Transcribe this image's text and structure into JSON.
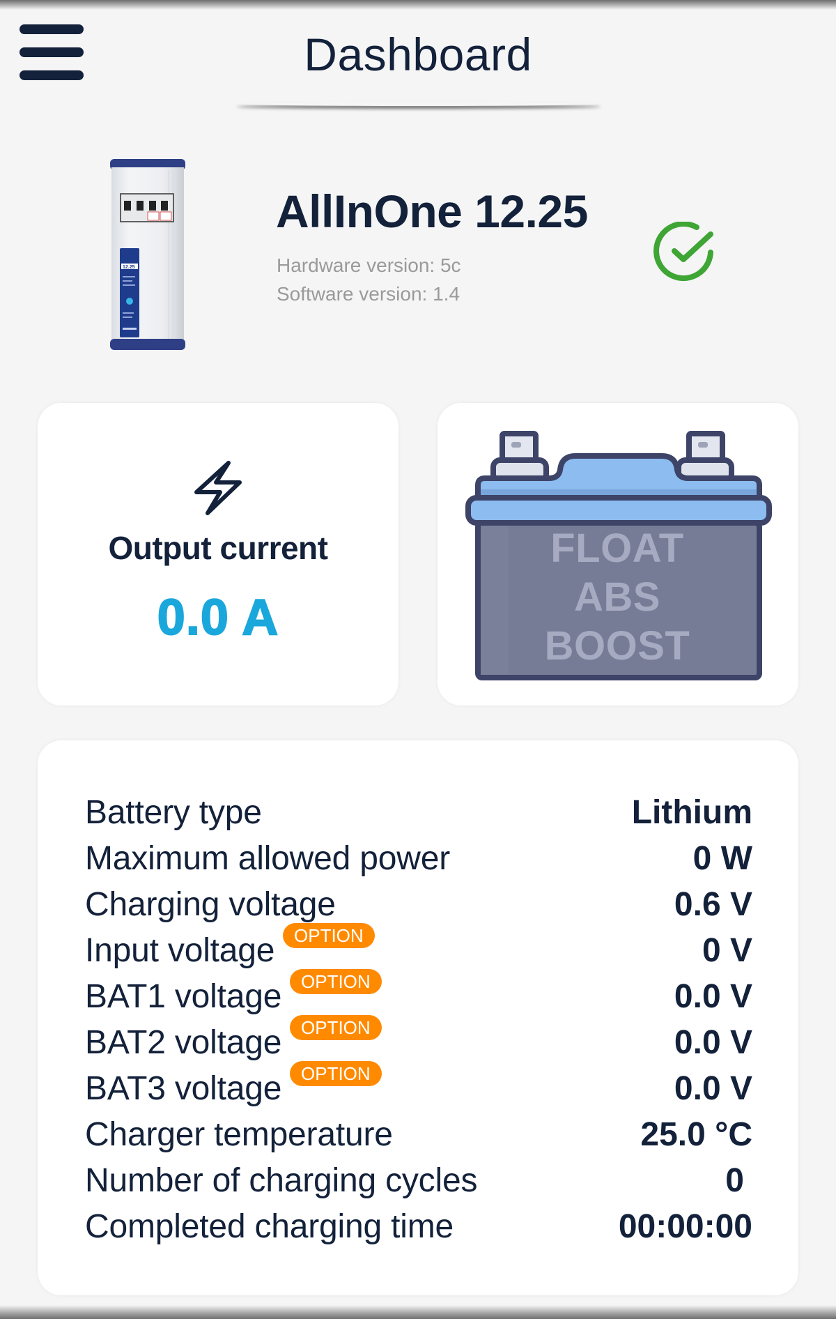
{
  "header": {
    "title": "Dashboard",
    "menu_icon": "hamburger-menu-icon"
  },
  "device": {
    "name": "AllInOne 12.25",
    "hardware_version": "Hardware version: 5c",
    "software_version": "Software version: 1.4",
    "status_icon": "check-circle-icon",
    "status_color": "#3fa535"
  },
  "output_card": {
    "icon": "lightning-bolt-icon",
    "label": "Output current",
    "value": "0.0 A",
    "value_color": "#1aa7dc"
  },
  "battery_card": {
    "icon": "battery-icon",
    "modes": [
      "FLOAT",
      "ABS",
      "BOOST"
    ]
  },
  "details": {
    "badge_label": "OPTION",
    "badge_color": "#ff8a00",
    "rows": [
      {
        "label": "Battery type",
        "value": "Lithium",
        "option": false
      },
      {
        "label": "Maximum allowed power",
        "value": "0 W",
        "option": false
      },
      {
        "label": "Charging voltage",
        "value": "0.6 V",
        "option": false
      },
      {
        "label": "Input voltage",
        "value": "0 V",
        "option": true
      },
      {
        "label": "BAT1 voltage",
        "value": "0.0 V",
        "option": true
      },
      {
        "label": "BAT2 voltage",
        "value": "0.0 V",
        "option": true
      },
      {
        "label": "BAT3 voltage",
        "value": "0.0 V",
        "option": true
      },
      {
        "label": "Charger temperature",
        "value": "25.0 °C",
        "option": false
      },
      {
        "label": "Number of charging cycles",
        "value": "0",
        "option": false
      },
      {
        "label": "Completed charging time",
        "value": "00:00:00",
        "option": false
      }
    ]
  }
}
